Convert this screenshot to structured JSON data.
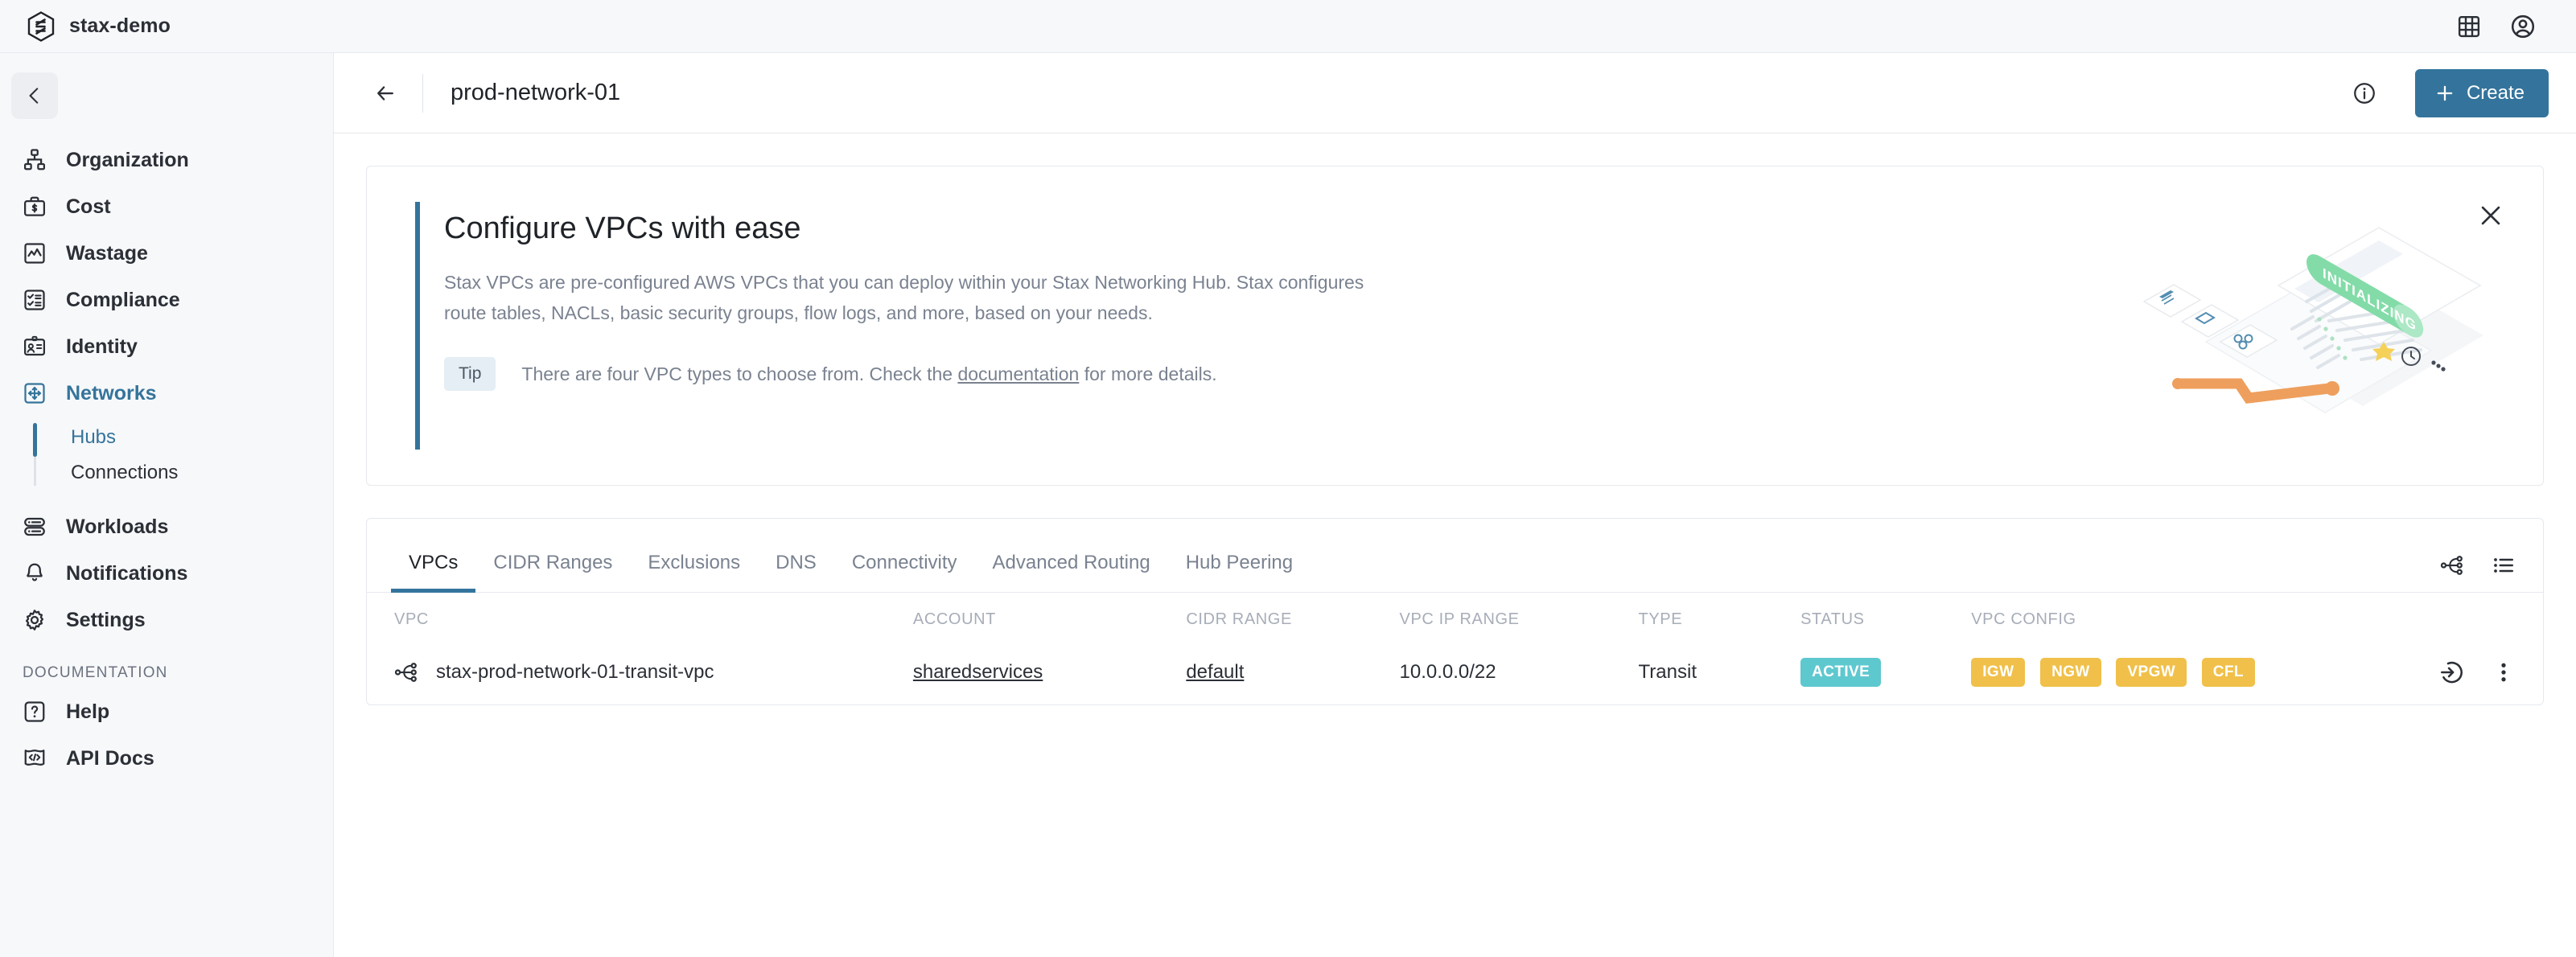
{
  "topbar": {
    "brand": "stax-demo",
    "logo_icon": "stax-hexagon-logo",
    "icons": [
      {
        "name": "apps-grid-icon"
      },
      {
        "name": "user-avatar-icon"
      }
    ]
  },
  "sidebar": {
    "collapse_icon": "chevron-left-icon",
    "items": [
      {
        "label": "Organization",
        "icon": "org-chart-icon",
        "active": false
      },
      {
        "label": "Cost",
        "icon": "briefcase-dollar-icon",
        "active": false
      },
      {
        "label": "Wastage",
        "icon": "chart-box-icon",
        "active": false
      },
      {
        "label": "Compliance",
        "icon": "checklist-icon",
        "active": false
      },
      {
        "label": "Identity",
        "icon": "id-card-icon",
        "active": false
      },
      {
        "label": "Networks",
        "icon": "network-arrows-icon",
        "active": true
      }
    ],
    "subitems": [
      {
        "label": "Hubs",
        "active": true
      },
      {
        "label": "Connections",
        "active": false
      }
    ],
    "items_after": [
      {
        "label": "Workloads",
        "icon": "server-stack-icon",
        "active": false
      },
      {
        "label": "Notifications",
        "icon": "bell-icon",
        "active": false
      },
      {
        "label": "Settings",
        "icon": "gear-icon",
        "active": false
      }
    ],
    "section_label": "DOCUMENTATION",
    "doc_items": [
      {
        "label": "Help",
        "icon": "question-box-icon",
        "active": false
      },
      {
        "label": "API Docs",
        "icon": "code-flag-icon",
        "active": false
      }
    ]
  },
  "page": {
    "back_icon": "arrow-left-icon",
    "title": "prod-network-01",
    "info_icon": "info-circle-icon",
    "create_label": "Create",
    "create_icon": "plus-icon",
    "create_color": "#34749c"
  },
  "banner": {
    "title": "Configure VPCs with ease",
    "description": "Stax VPCs are pre-configured AWS VPCs that you can deploy within your Stax Networking Hub. Stax configures route tables, NACLs, basic security groups, flow logs, and more, based on your needs.",
    "tip_label": "Tip",
    "tip_text_before": "There are four VPC types to choose from. Check the ",
    "tip_link": "documentation",
    "tip_text_after": " for more details.",
    "close_icon": "close-icon",
    "illustration_badge": "INITIALIZING",
    "accent_color": "#34749c"
  },
  "tabs": [
    {
      "label": "VPCs",
      "active": true
    },
    {
      "label": "CIDR Ranges",
      "active": false
    },
    {
      "label": "Exclusions",
      "active": false
    },
    {
      "label": "DNS",
      "active": false
    },
    {
      "label": "Connectivity",
      "active": false
    },
    {
      "label": "Advanced Routing",
      "active": false
    },
    {
      "label": "Hub Peering",
      "active": false
    }
  ],
  "view_toggles": [
    {
      "name": "topology-view-icon"
    },
    {
      "name": "list-view-icon"
    }
  ],
  "table": {
    "columns": [
      "VPC",
      "ACCOUNT",
      "CIDR RANGE",
      "VPC IP RANGE",
      "TYPE",
      "STATUS",
      "VPC CONFIG"
    ],
    "rows": [
      {
        "vpc_icon": "network-node-icon",
        "vpc": "stax-prod-network-01-transit-vpc",
        "account": "sharedservices",
        "cidr_range": "default",
        "vpc_ip_range": "10.0.0.0/22",
        "type": "Transit",
        "status": "ACTIVE",
        "status_color": "#5ec8cf",
        "config": [
          "IGW",
          "NGW",
          "VPGW",
          "CFL"
        ],
        "config_color": "#f0c04a",
        "actions": [
          {
            "name": "open-console-icon"
          },
          {
            "name": "more-options-icon"
          }
        ]
      }
    ]
  }
}
